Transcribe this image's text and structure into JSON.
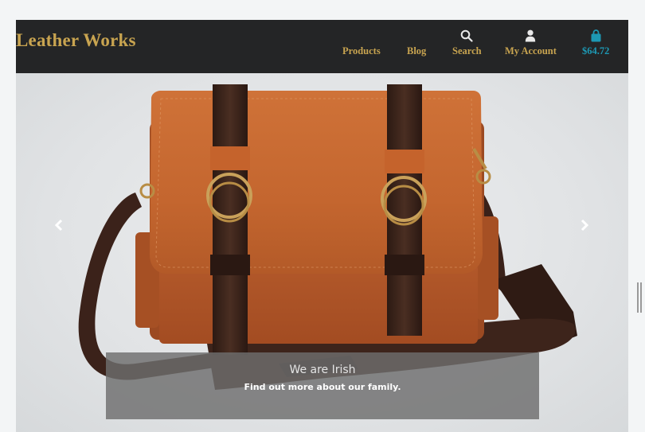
{
  "header": {
    "brand": "Leather Works",
    "nav": {
      "products": "Products",
      "blog": "Blog",
      "search": "Search",
      "account": "My Account",
      "cart_total": "$64.72"
    },
    "icons": {
      "search": "search-icon",
      "account": "user-icon",
      "cart": "shopping-bag-icon"
    },
    "colors": {
      "bar": "#242526",
      "gold": "#c8a450",
      "cart": "#1d98b3"
    }
  },
  "hero": {
    "image": "brown-leather-messenger-bag",
    "caption_title": "We are Irish",
    "caption_subtitle": "Find out more about our family.",
    "prev_icon": "chevron-left-icon",
    "next_icon": "chevron-right-icon"
  }
}
